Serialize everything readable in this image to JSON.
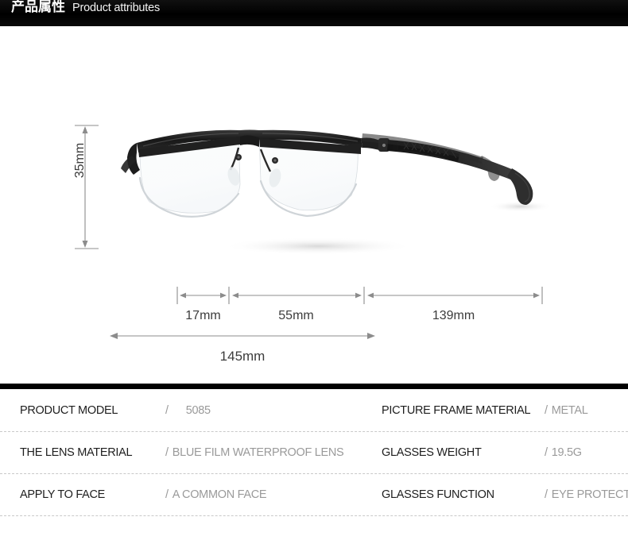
{
  "header": {
    "title_cn": "产品属性",
    "title_en": "Product attributes"
  },
  "diagram": {
    "lens_height": "35mm",
    "bridge_width": "17mm",
    "lens_width": "55mm",
    "temple_length": "139mm",
    "total_width": "145mm",
    "product_alt": "black semi-rimless metal eyeglasses"
  },
  "spec_table": {
    "rows": [
      {
        "left": {
          "label": "PRODUCT MODEL",
          "slash": "/",
          "value": "5085"
        },
        "right": {
          "label": "PICTURE FRAME MATERIAL",
          "slash": "/",
          "value": "METAL"
        }
      },
      {
        "left": {
          "label": "THE LENS MATERIAL",
          "slash": "/",
          "value": "BLUE FILM WATERPROOF LENS"
        },
        "right": {
          "label": "GLASSES WEIGHT",
          "slash": "/",
          "value": "19.5G"
        }
      },
      {
        "left": {
          "label": "APPLY TO FACE",
          "slash": "/",
          "value": "A COMMON FACE"
        },
        "right": {
          "label": "GLASSES FUNCTION",
          "slash": "/",
          "value": "EYE PROTECTOR"
        }
      }
    ]
  },
  "colors": {
    "header_bg": "#000000",
    "header_text": "#ffffff",
    "label_text": "#1e1e1e",
    "value_text": "#9a9a9a",
    "dimension_line": "#8c8c8c",
    "separator": "#c9c9c9"
  }
}
